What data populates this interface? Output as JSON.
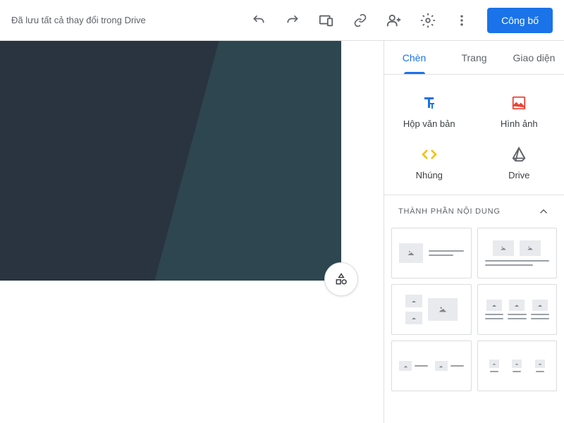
{
  "toolbar": {
    "save_status": "Đã lưu tất cả thay đổi trong Drive",
    "publish_label": "Công bố"
  },
  "sidebar": {
    "tabs": {
      "insert": "Chèn",
      "pages": "Trang",
      "themes": "Giao diện"
    },
    "insert_items": {
      "textbox": "Hộp văn bản",
      "image": "Hình ảnh",
      "embed": "Nhúng",
      "drive": "Drive"
    },
    "section_title": "THÀNH PHẦN NỘI DUNG"
  },
  "colors": {
    "primary": "#1a73e8",
    "text_icon": "#1a73e8",
    "image_icon": "#ea4335",
    "embed_icon": "#fbbc04",
    "drive_icon": "#5f6368"
  }
}
